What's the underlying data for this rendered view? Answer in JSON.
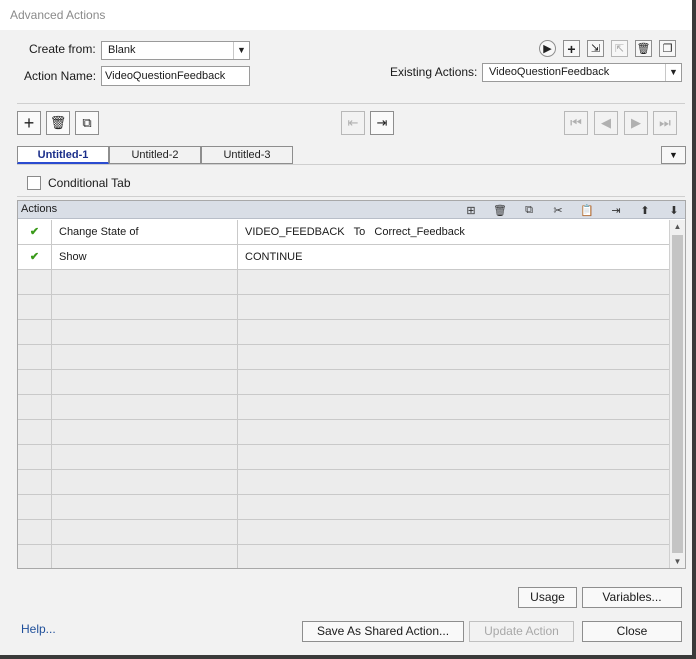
{
  "window": {
    "title": "Advanced Actions"
  },
  "form": {
    "create_from_label": "Create from:",
    "create_from_value": "Blank",
    "action_name_label": "Action Name:",
    "action_name_value": "VideoQuestionFeedback",
    "existing_actions_label": "Existing Actions:",
    "existing_actions_value": "VideoQuestionFeedback"
  },
  "tabs": [
    {
      "label": "Untitled-1",
      "active": true
    },
    {
      "label": "Untitled-2",
      "active": false
    },
    {
      "label": "Untitled-3",
      "active": false
    }
  ],
  "conditional_tab": {
    "label": "Conditional Tab",
    "checked": false
  },
  "actions_table": {
    "header": "Actions",
    "rows": [
      {
        "valid": true,
        "action": "Change State of",
        "target": "VIDEO_FEEDBACK   To   Correct_Feedback"
      },
      {
        "valid": true,
        "action": "Show",
        "target": "CONTINUE"
      }
    ],
    "empty_row_count": 12
  },
  "icons": {
    "preview": "play-icon",
    "new_action": "plus-icon",
    "import": "import-icon",
    "export": "export-icon",
    "delete": "trash-icon",
    "duplicate": "duplicate-icon",
    "check": "checkmark-icon"
  },
  "buttons": {
    "usage": "Usage",
    "variables": "Variables...",
    "help": "Help...",
    "save_shared": "Save As Shared Action...",
    "update": "Update Action",
    "close": "Close"
  },
  "colors": {
    "active_tab_text": "#1a2e8a",
    "check": "#3a9a1a",
    "link": "#1f4f9a"
  }
}
